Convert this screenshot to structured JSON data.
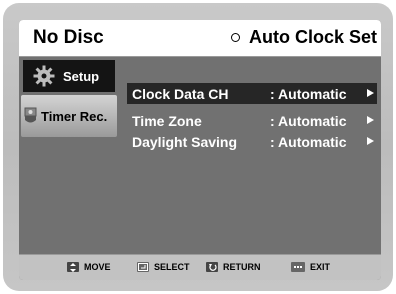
{
  "header": {
    "disc_status": "No Disc",
    "page_title": "Auto Clock Set",
    "page_title_icon": "circle-icon"
  },
  "sidebar": {
    "items": [
      {
        "label": "Setup",
        "icon": "gear-icon",
        "active": true
      },
      {
        "label": "Timer Rec.",
        "icon": "timer-icon",
        "active": false
      }
    ]
  },
  "options": [
    {
      "label": "Clock Data CH",
      "value": ": Automatic",
      "selected": true
    },
    {
      "label": "Time Zone",
      "value": ": Automatic",
      "selected": false
    },
    {
      "label": "Daylight Saving",
      "value": ": Automatic",
      "selected": false
    }
  ],
  "footer": {
    "move": "MOVE",
    "select": "SELECT",
    "return": "RETURN",
    "exit": "EXIT"
  },
  "colors": {
    "background": "#717171",
    "highlight": "#262626",
    "active_tab": "#141414",
    "text": "#ffffff"
  }
}
